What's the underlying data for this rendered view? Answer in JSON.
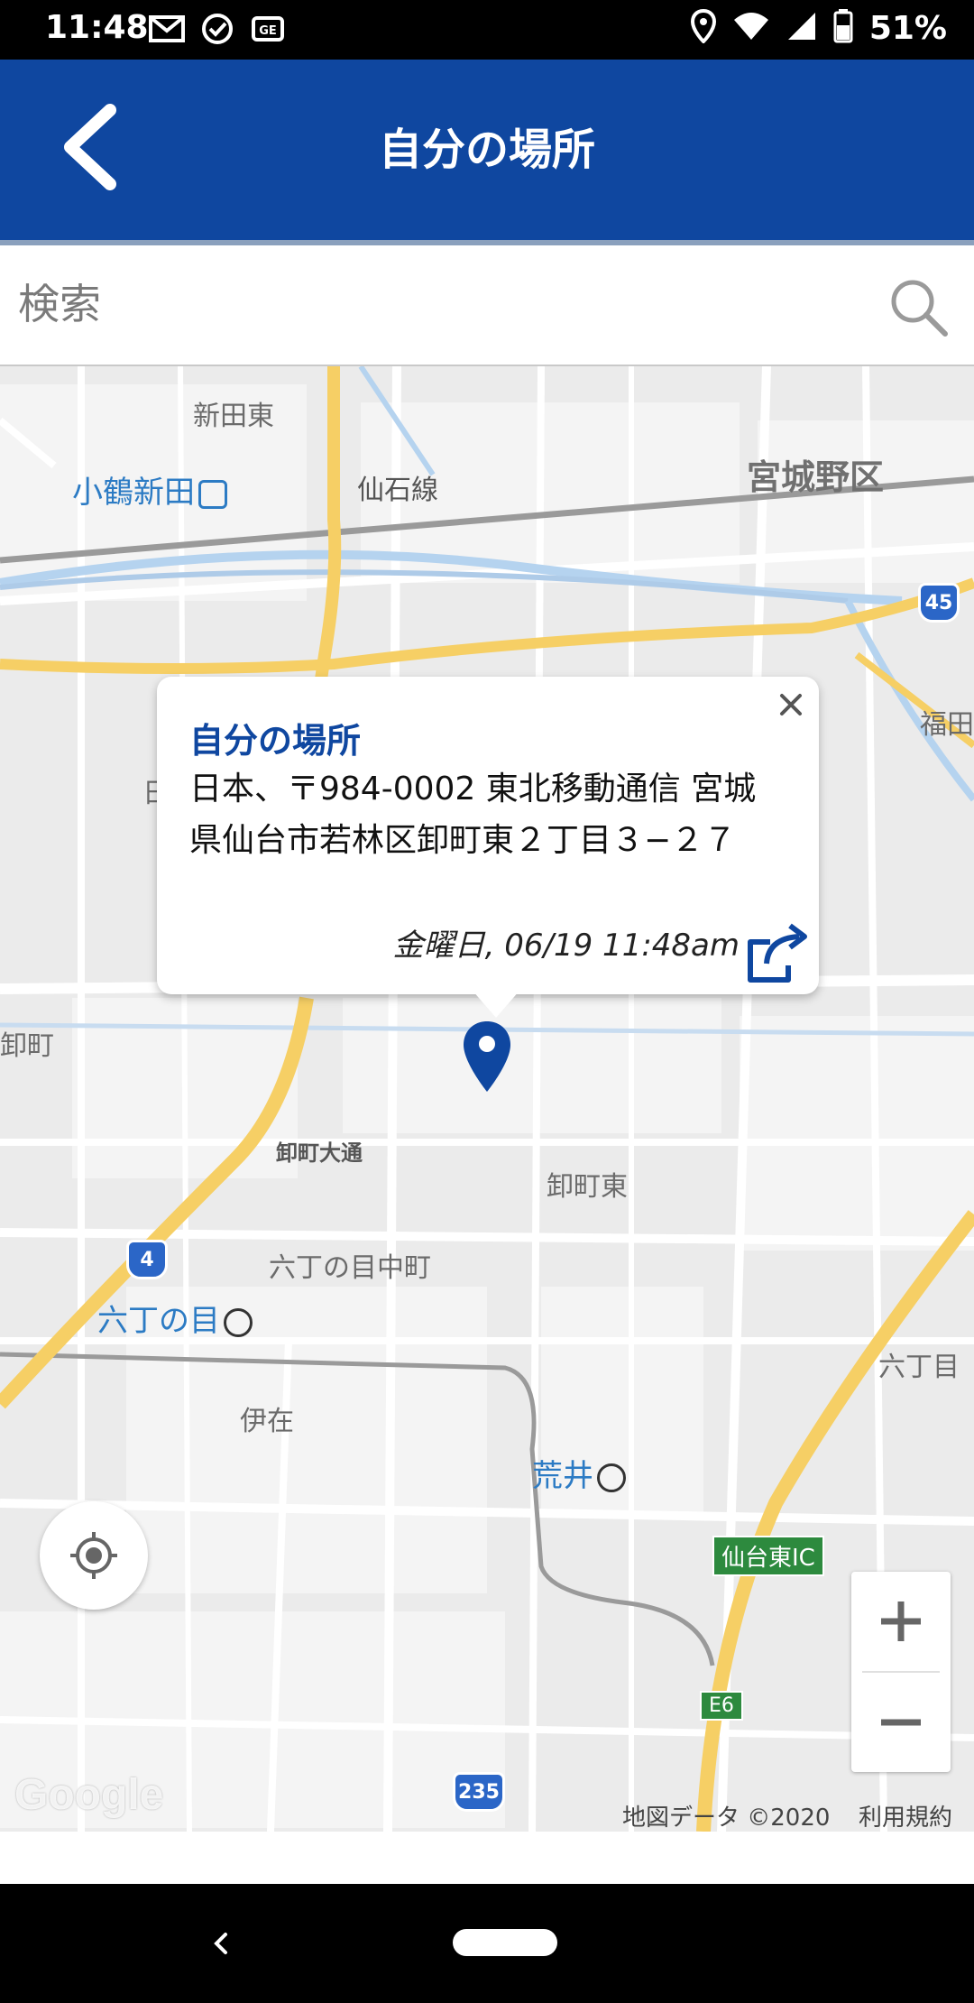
{
  "status_bar": {
    "time": "11:48",
    "battery": "51%",
    "icons_left": [
      "gmail-icon",
      "check-circle-icon",
      "ge-icon"
    ],
    "icons_right": [
      "location-icon",
      "wifi-icon",
      "signal-icon",
      "battery-icon"
    ]
  },
  "header": {
    "title": "自分の場所",
    "background": "#0f47a0"
  },
  "search": {
    "placeholder": "検索"
  },
  "map": {
    "labels": {
      "shindenhigashi": "新田東",
      "senseki_line": "仙石線",
      "miyaginoku": "宮城野区",
      "kozurushinden": "小鶴新田",
      "fukuda": "福田",
      "oroshimachi": "卸町",
      "oroshimachi_odori": "卸町大通",
      "oroshimachi_higashi": "卸町東",
      "rokuchonome_nakamachi": "六丁の目中町",
      "rokuchonome_station": "六丁の目",
      "rokuchonome_right": "六丁目",
      "isai": "伊在",
      "arai": "荒井",
      "sendai_higashi_ic": "仙台東IC",
      "e6": "E6",
      "route_45": "45",
      "route_4": "4",
      "route_235": "235",
      "partial_left": "日"
    },
    "attribution": "地図データ ©2020",
    "terms": "利用規約",
    "logo": "Google"
  },
  "popup": {
    "title": "自分の場所",
    "address": "日本、〒984-0002 東北移動通信 宮城県仙台市若林区卸町東２丁目３−２７",
    "timestamp": "金曜日, 06/19 11:48am"
  },
  "zoom": {
    "in": "+",
    "out": "−"
  }
}
